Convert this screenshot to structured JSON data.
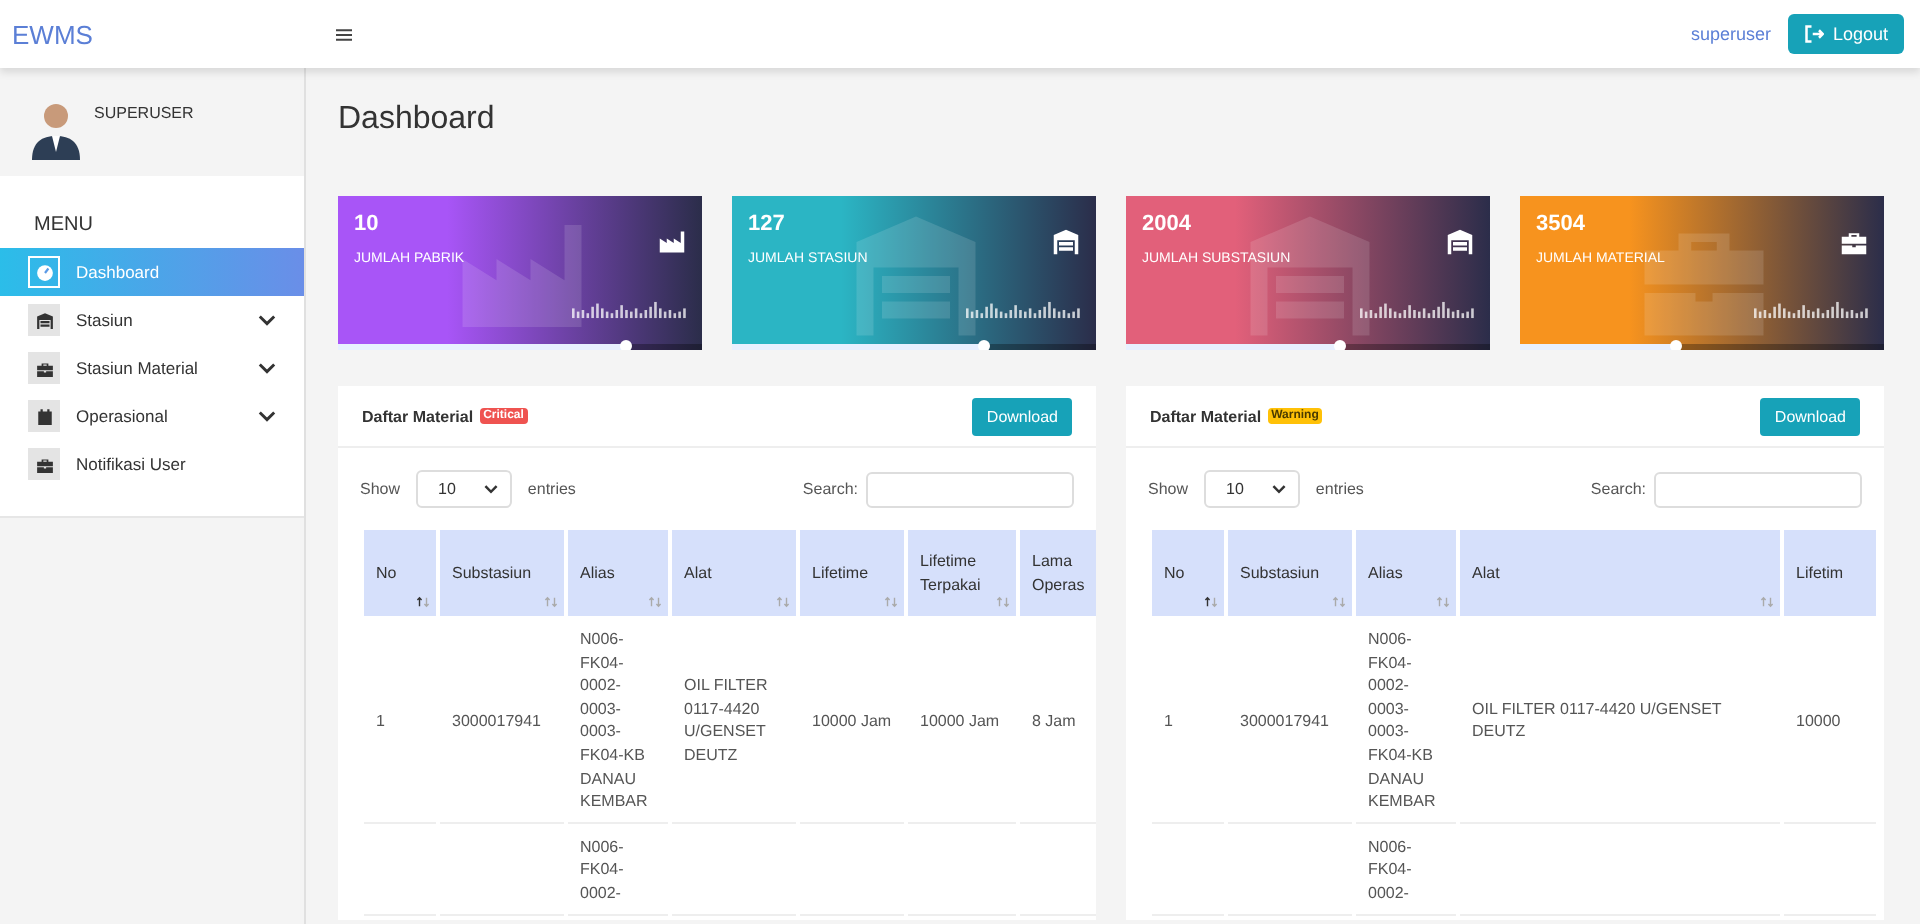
{
  "topbar": {
    "brand": "EWMS",
    "user": "superuser",
    "logout": "Logout"
  },
  "sidebar": {
    "profile_name": "SUPERUSER",
    "menu_title": "MENU",
    "items": [
      {
        "label": "Dashboard",
        "kind": "link",
        "selected": true
      },
      {
        "label": "Stasiun",
        "kind": "group",
        "selected": false
      },
      {
        "label": "Stasiun Material",
        "kind": "group",
        "selected": false
      },
      {
        "label": "Operasional",
        "kind": "group",
        "selected": false
      },
      {
        "label": "Notifikasi User",
        "kind": "link",
        "selected": false
      }
    ]
  },
  "page_title": "Dashboard",
  "cards": [
    {
      "value": "10",
      "label": "JUMLAH PABRIK",
      "color": "#a855f7",
      "level": 0.79
    },
    {
      "value": "127",
      "label": "JUMLAH STASIUN",
      "color": "#2bb5c4",
      "level": 0.69
    },
    {
      "value": "2004",
      "label": "JUMLAH SUBSTASIUN",
      "color": "#e2607a",
      "level": 0.59
    },
    {
      "value": "3504",
      "label": "JUMLAH MATERIAL",
      "color": "#f7931e",
      "level": 0.43
    }
  ],
  "panels": [
    {
      "title": "Daftar Material",
      "badge": {
        "text": "Critical",
        "kind": "danger"
      },
      "download": "Download",
      "show_label": "Show",
      "page_size": "10",
      "entries_label": "entries",
      "search_label": "Search:",
      "table": {
        "columns": [
          {
            "label": "No",
            "sorted": true
          },
          {
            "label": "Substasiun",
            "sorted": false
          },
          {
            "label": "Alias",
            "sorted": false
          },
          {
            "label": "Alat",
            "sorted": false
          },
          {
            "label": "Lifetime",
            "sorted": false
          },
          {
            "label": "Lifetime Terpakai",
            "sorted": false
          },
          {
            "label": "Lama Operas"
          }
        ],
        "rows": [
          {
            "cells": [
              "1",
              "3000017941",
              "N006-FK04-0002-0003-0003-FK04-KB DANAU KEMBAR",
              "OIL FILTER 0117-4420 U/GENSET DEUTZ",
              "10000 Jam",
              "10000 Jam",
              "8 Jam"
            ]
          },
          {
            "cells": [
              null,
              null,
              "N006-FK04-0002-",
              null,
              null,
              null,
              null
            ]
          }
        ]
      }
    },
    {
      "title": "Daftar Material",
      "badge": {
        "text": "Warning",
        "kind": "warning"
      },
      "download": "Download",
      "show_label": "Show",
      "page_size": "10",
      "entries_label": "entries",
      "search_label": "Search:",
      "table": {
        "columns": [
          {
            "label": "No",
            "sorted": true
          },
          {
            "label": "Substasiun",
            "sorted": false
          },
          {
            "label": "Alias",
            "sorted": false
          },
          {
            "label": "Alat",
            "sorted": false
          },
          {
            "label": "Lifetim"
          }
        ],
        "rows": [
          {
            "cells": [
              "1",
              "3000017941",
              "N006-FK04-0002-0003-0003-FK04-KB DANAU KEMBAR",
              "OIL FILTER 0117-4420 U/GENSET DEUTZ",
              "10000"
            ]
          },
          {
            "cells": [
              null,
              null,
              "N006-FK04-0002-",
              null,
              null
            ]
          }
        ]
      }
    }
  ]
}
